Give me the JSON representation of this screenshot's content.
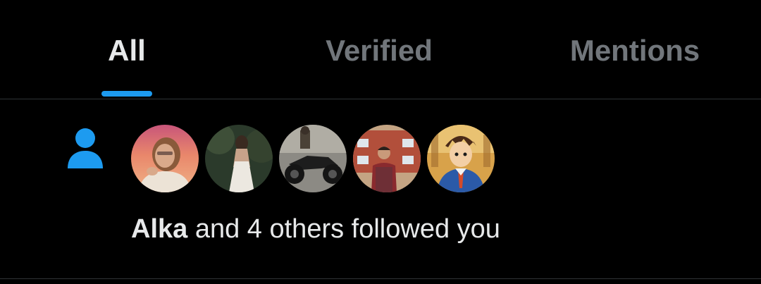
{
  "tabs": [
    {
      "label": "All",
      "active": true
    },
    {
      "label": "Verified",
      "active": false
    },
    {
      "label": "Mentions",
      "active": false
    }
  ],
  "colors": {
    "background": "#000000",
    "accent": "#1d9bf0",
    "text_primary": "#e7e9ea",
    "text_secondary": "#71767b",
    "divider": "#2f3336"
  },
  "notification": {
    "type_icon": "person-icon",
    "avatars": [
      {
        "name": "Alka",
        "icon": "avatar-photo"
      },
      {
        "icon": "avatar-photo"
      },
      {
        "icon": "avatar-photo"
      },
      {
        "icon": "avatar-photo"
      },
      {
        "icon": "avatar-photo"
      }
    ],
    "actor_name": "Alka",
    "message_rest": " and 4 others followed you"
  }
}
